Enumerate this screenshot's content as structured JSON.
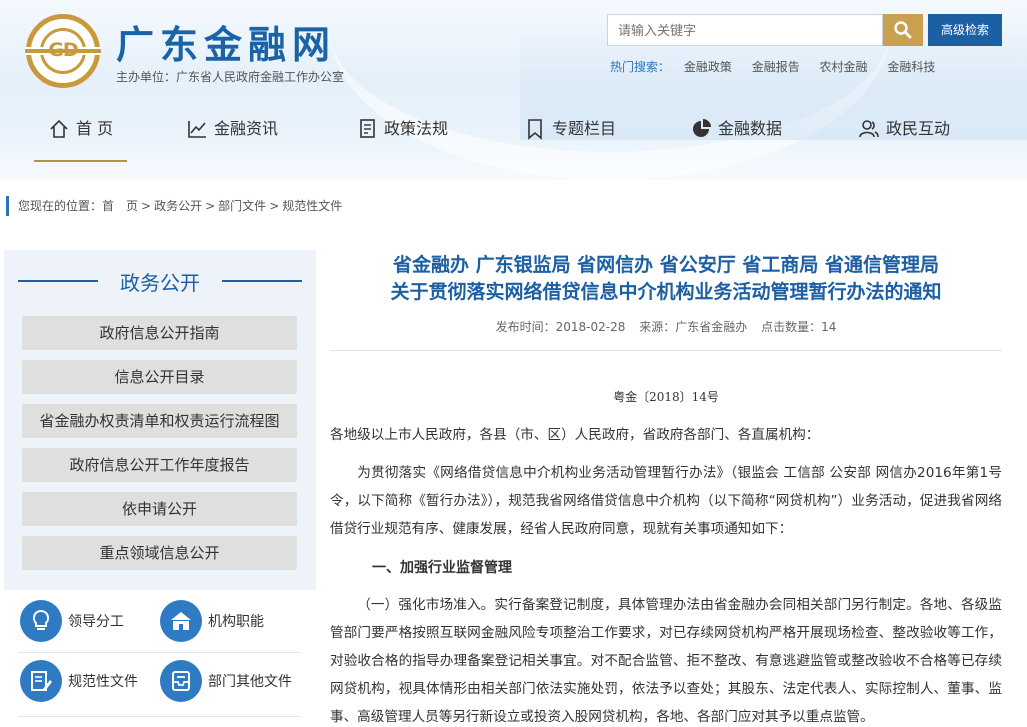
{
  "header": {
    "logo_text": "GD",
    "site_title": "广东金融网",
    "sponsor": "主办单位：广东省人民政府金融工作办公室",
    "search_placeholder": "请输入关键字",
    "advanced_search": "高级检索",
    "hot_label": "热门搜索：",
    "hot_keywords": [
      "金融政策",
      "金融报告",
      "农村金融",
      "金融科技"
    ]
  },
  "nav": {
    "items": [
      {
        "label": "首 页",
        "icon": "home-icon",
        "active": true
      },
      {
        "label": "金融资讯",
        "icon": "chart-line-icon"
      },
      {
        "label": "政策法规",
        "icon": "document-icon"
      },
      {
        "label": "专题栏目",
        "icon": "bookmark-icon"
      },
      {
        "label": "金融数据",
        "icon": "pie-chart-icon"
      },
      {
        "label": "政民互动",
        "icon": "users-icon"
      }
    ]
  },
  "breadcrumb": {
    "prefix": "您现在的位置：",
    "items": [
      "首　页",
      "政务公开",
      "部门文件",
      "规范性文件"
    ],
    "separator": ">"
  },
  "sidebar": {
    "heading": "政务公开",
    "menu": [
      "政府信息公开指南",
      "信息公开目录",
      "省金融办权责清单和权责运行流程图",
      "政府信息公开工作年度报告",
      "依申请公开",
      "重点领域信息公开"
    ],
    "quick_links": [
      {
        "label": "领导分工",
        "icon": "lightbulb-icon"
      },
      {
        "label": "机构职能",
        "icon": "building-icon"
      },
      {
        "label": "规范性文件",
        "icon": "edit-document-icon"
      },
      {
        "label": "部门其他文件",
        "icon": "inbox-icon"
      }
    ]
  },
  "article": {
    "title_line1": "省金融办 广东银监局 省网信办 省公安厅 省工商局 省通信管理局",
    "title_line2": "关于贯彻落实网络借贷信息中介机构业务活动管理暂行办法的通知",
    "publish_label": "发布时间：2018-02-28",
    "source_label": "来源：广东省金融办",
    "clicks_label": "点击数量：14",
    "doc_number": "粤金〔2018〕14号",
    "salutation": "各地级以上市人民政府，各县（市、区）人民政府，省政府各部门、各直属机构：",
    "intro": "为贯彻落实《网络借贷信息中介机构业务活动管理暂行办法》（银监会 工信部 公安部 网信办2016年第1号令，以下简称《暂行办法》），规范我省网络借贷信息中介机构（以下简称“网贷机构”）业务活动，促进我省网络借贷行业规范有序、健康发展，经省人民政府同意，现就有关事项通知如下：",
    "section1": "一、加强行业监督管理",
    "para1": "（一）强化市场准入。实行备案登记制度，具体管理办法由省金融办会同相关部门另行制定。各地、各级监管部门要严格按照互联网金融风险专项整治工作要求，对已存续网贷机构严格开展现场检查、整改验收等工作，对验收合格的指导办理备案登记相关事宜。对不配合监管、拒不整改、有意逃避监管或整改验收不合格等已存续网贷机构，视具体情形由相关部门依法实施处罚，依法予以查处；其股东、法定代表人、实际控制人、董事、监事、高级管理人员等另行新设立或投资入股网贷机构，各地、各部门应对其予以重点监管。"
  },
  "colors": {
    "brand_blue": "#1d5fa3",
    "gold": "#c8a050",
    "sidebar_bg": "#eef3fa"
  }
}
